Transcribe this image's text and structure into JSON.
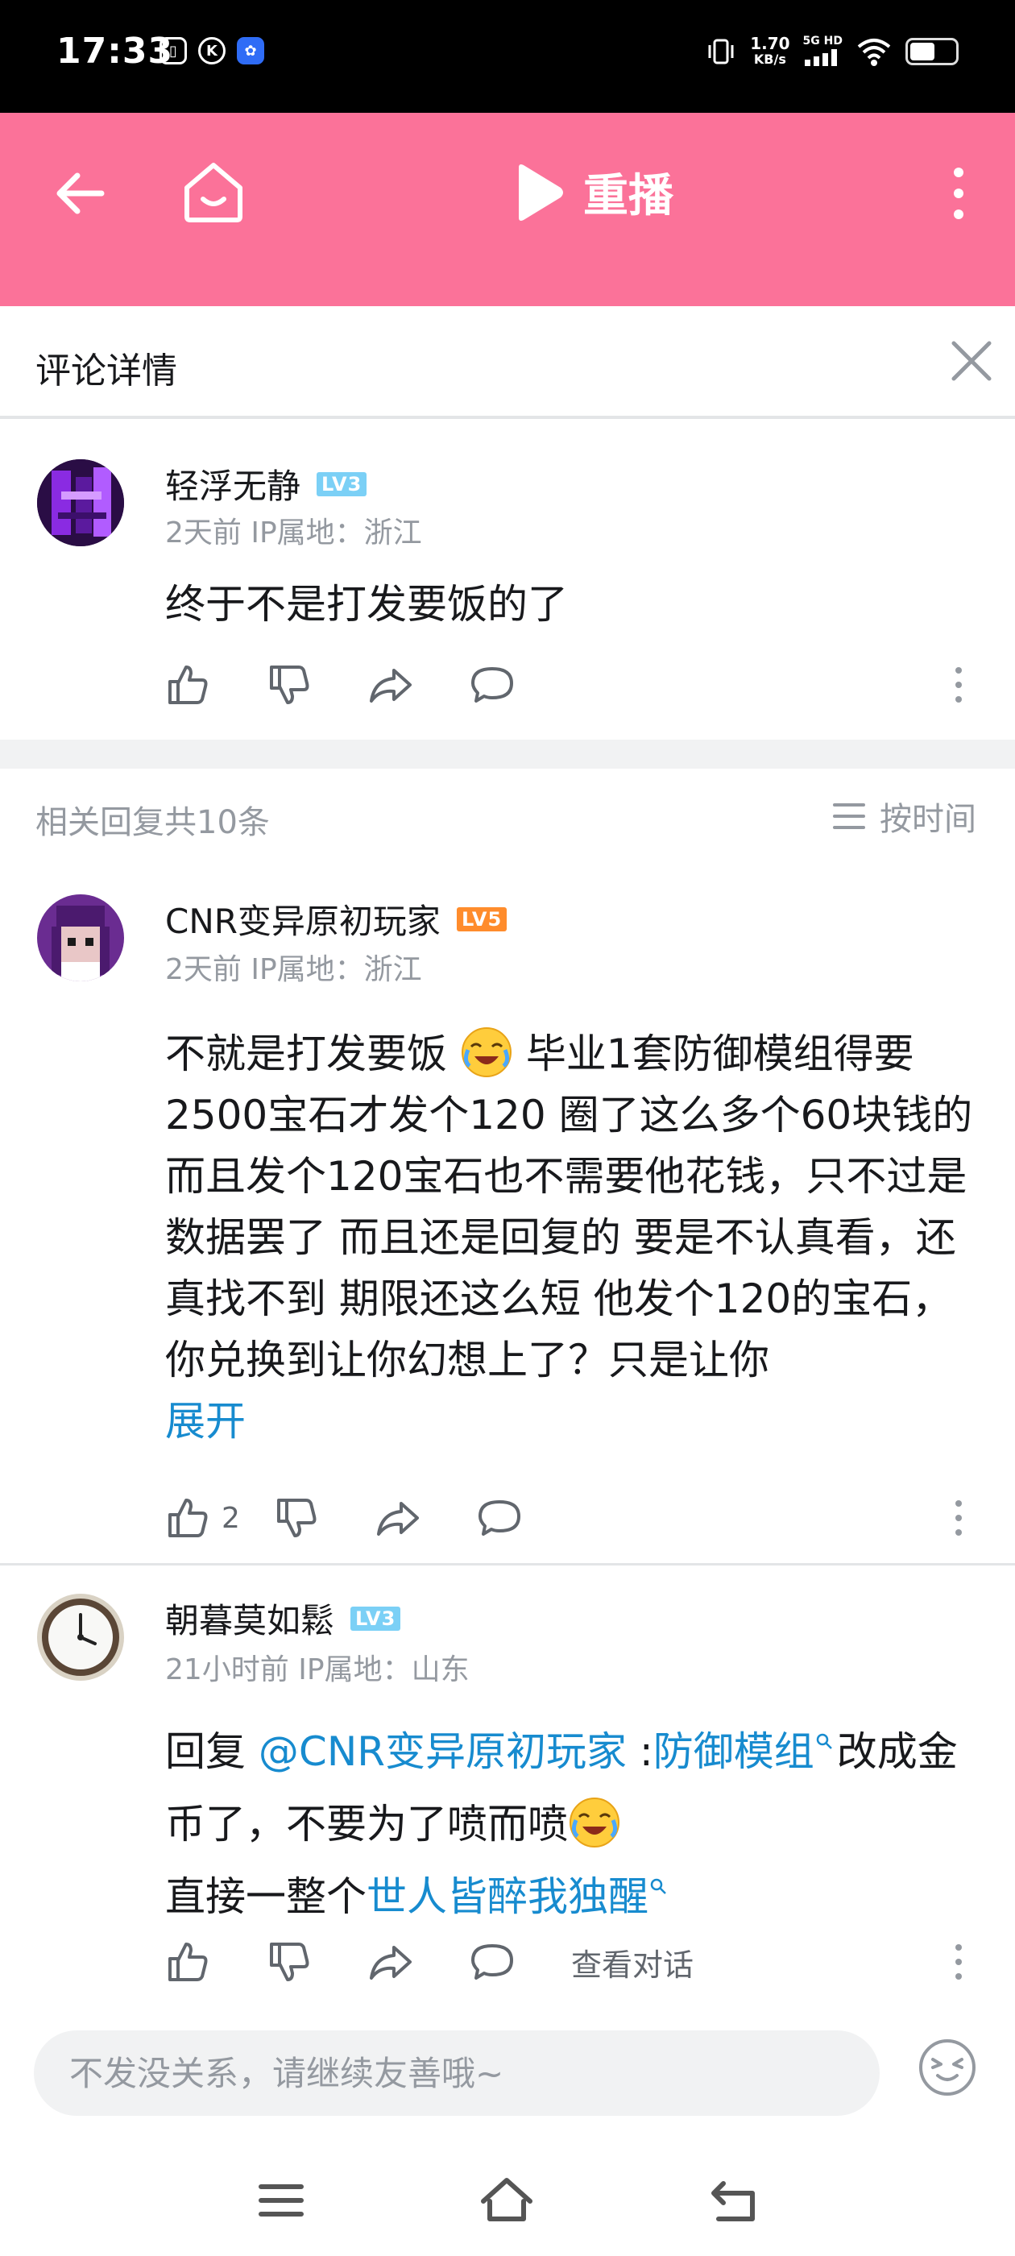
{
  "status_bar": {
    "time": "17:33",
    "net_speed_value": "1.70",
    "net_speed_unit": "KB/s",
    "network_type": "5G HD"
  },
  "topbar": {
    "replay_label": "重播",
    "accent_color": "#fb7299"
  },
  "detail": {
    "title": "评论详情"
  },
  "root_comment": {
    "username": "轻浮无静",
    "level": "LV3",
    "meta": "2天前 IP属地：浙江",
    "content": "终于不是打发要饭的了"
  },
  "replies_header": {
    "count_text": "相关回复共10条",
    "sort_label": "按时间"
  },
  "replies": [
    {
      "username": "CNR变异原初玩家",
      "level": "LV5",
      "meta": "2天前 IP属地：浙江",
      "content_part1": "不就是打发要饭",
      "content_part2": "毕业1套防御模组得要2500宝石才发个120 圈了这么多个60块钱的 而且发个120宝石也不需要他花钱，只不过是数据罢了 而且还是回复的 要是不认真看，还真找不到 期限还这么短 他发个120的宝石，你兑换到让你幻想上了？只是让你",
      "expand_label": "展开",
      "like_count": "2"
    },
    {
      "username": "朝暮莫如鬆",
      "level": "LV3",
      "meta": "21小时前 IP属地：山东",
      "reply_prefix": "回复 ",
      "mention": "@CNR变异原初玩家",
      "colon": " :",
      "keyword1": "防御模组",
      "text1": "改成金币了，不要为了喷而喷",
      "text2": "直接一整个",
      "keyword2": "世人皆醉我独醒",
      "view_dialog_label": "查看对话"
    }
  ],
  "input": {
    "placeholder": "不发没关系，请继续友善哦~"
  }
}
